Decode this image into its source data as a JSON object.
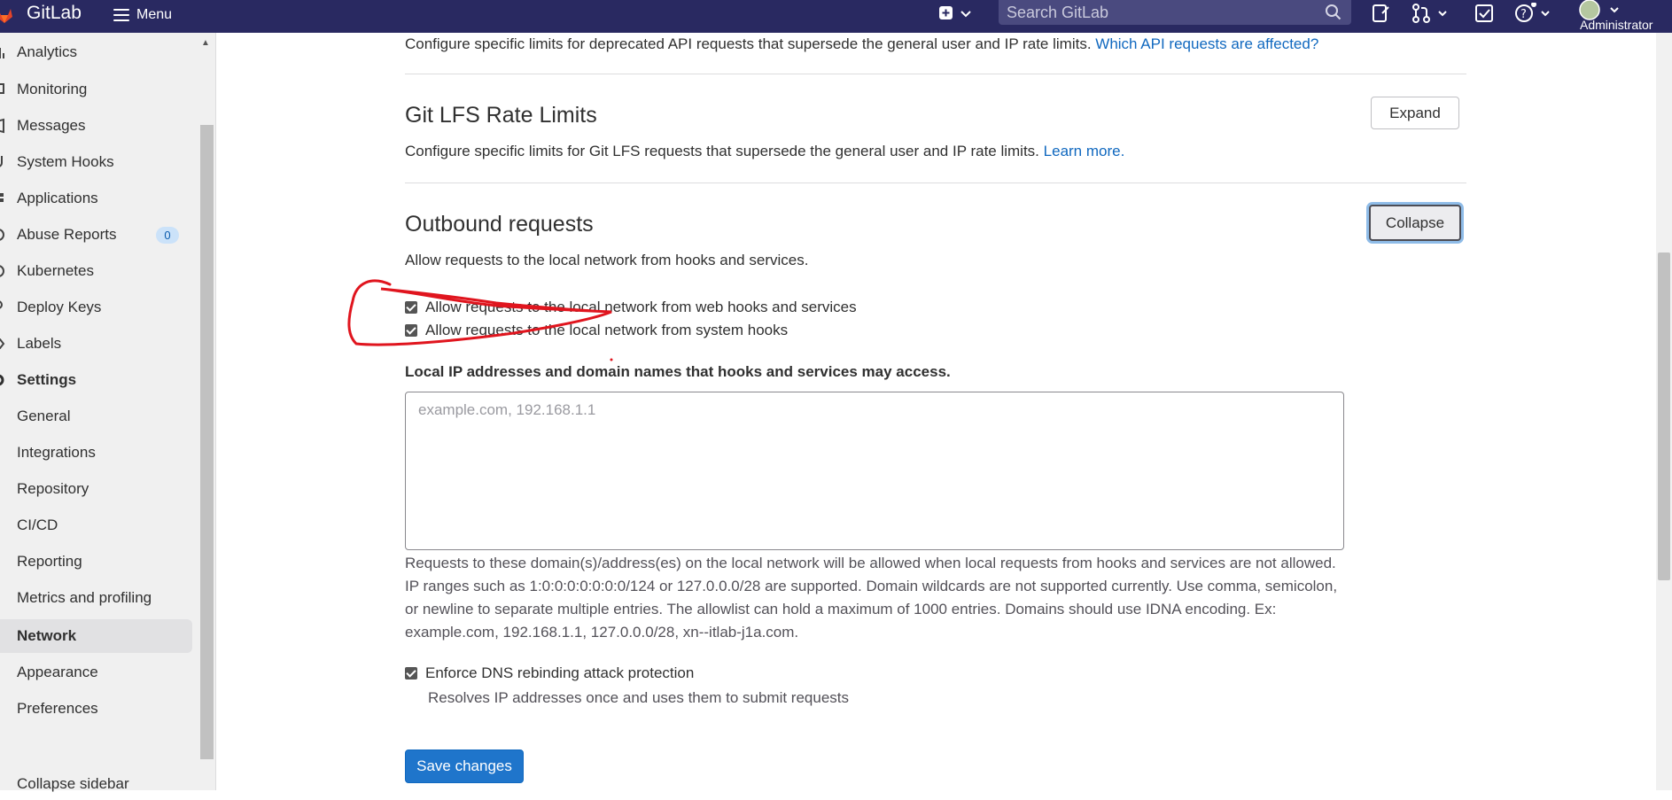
{
  "topbar": {
    "brand": "GitLab",
    "menu_label": "Menu",
    "search_placeholder": "Search GitLab",
    "user_label": "Administrator"
  },
  "sidebar": {
    "items": [
      {
        "label": "Analytics"
      },
      {
        "label": "Monitoring"
      },
      {
        "label": "Messages"
      },
      {
        "label": "System Hooks"
      },
      {
        "label": "Applications"
      },
      {
        "label": "Abuse Reports",
        "badge": "0"
      },
      {
        "label": "Kubernetes"
      },
      {
        "label": "Deploy Keys"
      },
      {
        "label": "Labels"
      },
      {
        "label": "Settings"
      },
      {
        "label": "General"
      },
      {
        "label": "Integrations"
      },
      {
        "label": "Repository"
      },
      {
        "label": "CI/CD"
      },
      {
        "label": "Reporting"
      },
      {
        "label": "Metrics and profiling"
      },
      {
        "label": "Network"
      },
      {
        "label": "Appearance"
      },
      {
        "label": "Preferences"
      }
    ],
    "collapse_label": "Collapse sidebar"
  },
  "sections": {
    "deprecated_api": {
      "description": "Configure specific limits for deprecated API requests that supersede the general user and IP rate limits.",
      "link": "Which API requests are affected?"
    },
    "git_lfs": {
      "title": "Git LFS Rate Limits",
      "button": "Expand",
      "description": "Configure specific limits for Git LFS requests that supersede the general user and IP rate limits.",
      "link": "Learn more."
    },
    "outbound": {
      "title": "Outbound requests",
      "button": "Collapse",
      "description": "Allow requests to the local network from hooks and services.",
      "checkbox_web_hooks": "Allow requests to the local network from web hooks and services",
      "checkbox_system_hooks": "Allow requests to the local network from system hooks",
      "allowlist_label": "Local IP addresses and domain names that hooks and services may access.",
      "allowlist_placeholder": "example.com, 192.168.1.1",
      "allowlist_help": "Requests to these domain(s)/address(es) on the local network will be allowed when local requests from hooks and services are not allowed. IP ranges such as 1:0:0:0:0:0:0:0/124 or 127.0.0.0/28 are supported. Domain wildcards are not supported currently. Use comma, semicolon, or newline to separate multiple entries. The allowlist can hold a maximum of 1000 entries. Domains should use IDNA encoding. Ex: example.com, 192.168.1.1, 127.0.0.0/28, xn--itlab-j1a.com.",
      "dns_rebinding_label": "Enforce DNS rebinding attack protection",
      "dns_rebinding_help": "Resolves IP addresses once and uses them to submit requests",
      "save_button": "Save changes"
    }
  },
  "colors": {
    "topbar": "#292961",
    "primary": "#1f75cb",
    "link": "#1068bf",
    "annotation": "#e0151e"
  }
}
